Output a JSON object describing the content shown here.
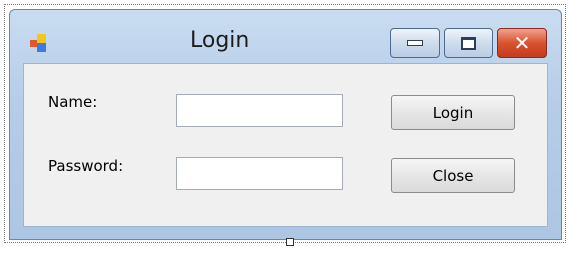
{
  "window": {
    "title": "Login",
    "icon": "app-form-icon",
    "caption_buttons": [
      "minimize-icon",
      "maximize-icon",
      "close-icon"
    ],
    "close_glyph": "✕"
  },
  "form": {
    "name_label": "Name:",
    "name_value": "",
    "password_label": "Password:",
    "password_value": "",
    "login_button": "Login",
    "close_button": "Close"
  }
}
